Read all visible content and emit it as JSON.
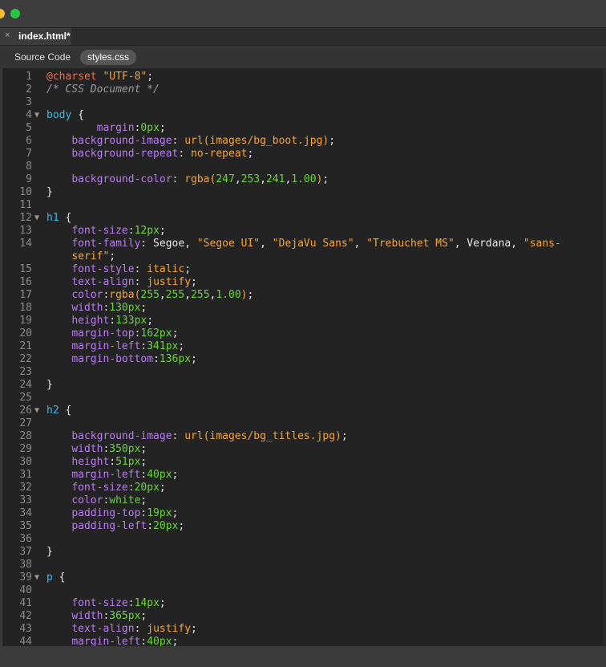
{
  "tab": {
    "close": "×",
    "filename": "index.html*"
  },
  "related_files": [
    "Source Code",
    "styles.css"
  ],
  "lines": [
    {
      "n": "1",
      "tokens": [
        [
          "at",
          "@charset"
        ],
        [
          "txt",
          " "
        ],
        [
          "str",
          "\"UTF-8\""
        ],
        [
          "txt",
          ";"
        ]
      ]
    },
    {
      "n": "2",
      "tokens": [
        [
          "com",
          "/* CSS Document */"
        ]
      ]
    },
    {
      "n": "3",
      "tokens": []
    },
    {
      "n": "4",
      "fold": "▼",
      "tokens": [
        [
          "sel",
          "body"
        ],
        [
          "txt",
          " {"
        ]
      ]
    },
    {
      "n": "5",
      "tokens": [
        [
          "txt",
          "        "
        ],
        [
          "prop",
          "margin"
        ],
        [
          "txt",
          ":"
        ],
        [
          "num",
          "0px"
        ],
        [
          "txt",
          ";"
        ]
      ]
    },
    {
      "n": "6",
      "tokens": [
        [
          "txt",
          "    "
        ],
        [
          "prop",
          "background-image"
        ],
        [
          "txt",
          ": "
        ],
        [
          "fn",
          "url(images/bg_boot.jpg)"
        ],
        [
          "txt",
          ";"
        ]
      ]
    },
    {
      "n": "7",
      "tokens": [
        [
          "txt",
          "    "
        ],
        [
          "prop",
          "background-repeat"
        ],
        [
          "txt",
          ": "
        ],
        [
          "kw",
          "no-repeat"
        ],
        [
          "txt",
          ";"
        ]
      ]
    },
    {
      "n": "8",
      "tokens": []
    },
    {
      "n": "9",
      "tokens": [
        [
          "txt",
          "    "
        ],
        [
          "prop",
          "background-color"
        ],
        [
          "txt",
          ": "
        ],
        [
          "fn",
          "rgba("
        ],
        [
          "num",
          "247"
        ],
        [
          "txt",
          ","
        ],
        [
          "num",
          "253"
        ],
        [
          "txt",
          ","
        ],
        [
          "num",
          "241"
        ],
        [
          "txt",
          ","
        ],
        [
          "num",
          "1.00"
        ],
        [
          "fn",
          ")"
        ],
        [
          "txt",
          ";"
        ]
      ]
    },
    {
      "n": "10",
      "tokens": [
        [
          "txt",
          "}"
        ]
      ]
    },
    {
      "n": "11",
      "tokens": []
    },
    {
      "n": "12",
      "fold": "▼",
      "tokens": [
        [
          "sel",
          "h1"
        ],
        [
          "txt",
          " {"
        ]
      ]
    },
    {
      "n": "13",
      "tokens": [
        [
          "txt",
          "    "
        ],
        [
          "prop",
          "font-size"
        ],
        [
          "txt",
          ":"
        ],
        [
          "num",
          "12px"
        ],
        [
          "txt",
          ";"
        ]
      ]
    },
    {
      "n": "14",
      "tokens": [
        [
          "txt",
          "    "
        ],
        [
          "prop",
          "font-family"
        ],
        [
          "txt",
          ": Segoe, "
        ],
        [
          "str",
          "\"Segoe UI\""
        ],
        [
          "txt",
          ", "
        ],
        [
          "str",
          "\"DejaVu Sans\""
        ],
        [
          "txt",
          ", "
        ],
        [
          "str",
          "\"Trebuchet MS\""
        ],
        [
          "txt",
          ", Verdana, "
        ],
        [
          "str",
          "\"sans-"
        ]
      ]
    },
    {
      "n": "",
      "tokens": [
        [
          "txt",
          "    "
        ],
        [
          "str",
          "serif\""
        ],
        [
          "txt",
          ";"
        ]
      ]
    },
    {
      "n": "15",
      "tokens": [
        [
          "txt",
          "    "
        ],
        [
          "prop",
          "font-style"
        ],
        [
          "txt",
          ": "
        ],
        [
          "kw",
          "italic"
        ],
        [
          "txt",
          ";"
        ]
      ]
    },
    {
      "n": "16",
      "tokens": [
        [
          "txt",
          "    "
        ],
        [
          "prop",
          "text-align"
        ],
        [
          "txt",
          ": "
        ],
        [
          "kw",
          "justify"
        ],
        [
          "txt",
          ";"
        ]
      ]
    },
    {
      "n": "17",
      "tokens": [
        [
          "txt",
          "    "
        ],
        [
          "prop",
          "color"
        ],
        [
          "txt",
          ":"
        ],
        [
          "fn",
          "rgba("
        ],
        [
          "num",
          "255"
        ],
        [
          "txt",
          ","
        ],
        [
          "num",
          "255"
        ],
        [
          "txt",
          ","
        ],
        [
          "num",
          "255"
        ],
        [
          "txt",
          ","
        ],
        [
          "num",
          "1.00"
        ],
        [
          "fn",
          ")"
        ],
        [
          "txt",
          ";"
        ]
      ]
    },
    {
      "n": "18",
      "tokens": [
        [
          "txt",
          "    "
        ],
        [
          "prop",
          "width"
        ],
        [
          "txt",
          ":"
        ],
        [
          "num",
          "130px"
        ],
        [
          "txt",
          ";"
        ]
      ]
    },
    {
      "n": "19",
      "tokens": [
        [
          "txt",
          "    "
        ],
        [
          "prop",
          "height"
        ],
        [
          "txt",
          ":"
        ],
        [
          "num",
          "133px"
        ],
        [
          "txt",
          ";"
        ]
      ]
    },
    {
      "n": "20",
      "tokens": [
        [
          "txt",
          "    "
        ],
        [
          "prop",
          "margin-top"
        ],
        [
          "txt",
          ":"
        ],
        [
          "num",
          "162px"
        ],
        [
          "txt",
          ";"
        ]
      ]
    },
    {
      "n": "21",
      "tokens": [
        [
          "txt",
          "    "
        ],
        [
          "prop",
          "margin-left"
        ],
        [
          "txt",
          ":"
        ],
        [
          "num",
          "341px"
        ],
        [
          "txt",
          ";"
        ]
      ]
    },
    {
      "n": "22",
      "tokens": [
        [
          "txt",
          "    "
        ],
        [
          "prop",
          "margin-bottom"
        ],
        [
          "txt",
          ":"
        ],
        [
          "num",
          "136px"
        ],
        [
          "txt",
          ";"
        ]
      ]
    },
    {
      "n": "23",
      "tokens": []
    },
    {
      "n": "24",
      "tokens": [
        [
          "txt",
          "}"
        ]
      ]
    },
    {
      "n": "25",
      "tokens": []
    },
    {
      "n": "26",
      "fold": "▼",
      "tokens": [
        [
          "sel",
          "h2"
        ],
        [
          "txt",
          " {"
        ]
      ]
    },
    {
      "n": "27",
      "tokens": []
    },
    {
      "n": "28",
      "tokens": [
        [
          "txt",
          "    "
        ],
        [
          "prop",
          "background-image"
        ],
        [
          "txt",
          ": "
        ],
        [
          "fn",
          "url(images/bg_titles.jpg)"
        ],
        [
          "txt",
          ";"
        ]
      ]
    },
    {
      "n": "29",
      "tokens": [
        [
          "txt",
          "    "
        ],
        [
          "prop",
          "width"
        ],
        [
          "txt",
          ":"
        ],
        [
          "num",
          "350px"
        ],
        [
          "txt",
          ";"
        ]
      ]
    },
    {
      "n": "30",
      "tokens": [
        [
          "txt",
          "    "
        ],
        [
          "prop",
          "height"
        ],
        [
          "txt",
          ":"
        ],
        [
          "num",
          "51px"
        ],
        [
          "txt",
          ";"
        ]
      ]
    },
    {
      "n": "31",
      "tokens": [
        [
          "txt",
          "    "
        ],
        [
          "prop",
          "margin-left"
        ],
        [
          "txt",
          ":"
        ],
        [
          "num",
          "40px"
        ],
        [
          "txt",
          ";"
        ]
      ]
    },
    {
      "n": "32",
      "tokens": [
        [
          "txt",
          "    "
        ],
        [
          "prop",
          "font-size"
        ],
        [
          "txt",
          ":"
        ],
        [
          "num",
          "20px"
        ],
        [
          "txt",
          ";"
        ]
      ]
    },
    {
      "n": "33",
      "tokens": [
        [
          "txt",
          "    "
        ],
        [
          "prop",
          "color"
        ],
        [
          "txt",
          ":"
        ],
        [
          "num",
          "white"
        ],
        [
          "txt",
          ";"
        ]
      ]
    },
    {
      "n": "34",
      "tokens": [
        [
          "txt",
          "    "
        ],
        [
          "prop",
          "padding-top"
        ],
        [
          "txt",
          ":"
        ],
        [
          "num",
          "19px"
        ],
        [
          "txt",
          ";"
        ]
      ]
    },
    {
      "n": "35",
      "tokens": [
        [
          "txt",
          "    "
        ],
        [
          "prop",
          "padding-left"
        ],
        [
          "txt",
          ":"
        ],
        [
          "num",
          "20px"
        ],
        [
          "txt",
          ";"
        ]
      ]
    },
    {
      "n": "36",
      "tokens": []
    },
    {
      "n": "37",
      "tokens": [
        [
          "txt",
          "}"
        ]
      ]
    },
    {
      "n": "38",
      "tokens": []
    },
    {
      "n": "39",
      "fold": "▼",
      "tokens": [
        [
          "sel",
          "p"
        ],
        [
          "txt",
          " {"
        ]
      ]
    },
    {
      "n": "40",
      "tokens": []
    },
    {
      "n": "41",
      "tokens": [
        [
          "txt",
          "    "
        ],
        [
          "prop",
          "font-size"
        ],
        [
          "txt",
          ":"
        ],
        [
          "num",
          "14px"
        ],
        [
          "txt",
          ";"
        ]
      ]
    },
    {
      "n": "42",
      "tokens": [
        [
          "txt",
          "    "
        ],
        [
          "prop",
          "width"
        ],
        [
          "txt",
          ":"
        ],
        [
          "num",
          "365px"
        ],
        [
          "txt",
          ";"
        ]
      ]
    },
    {
      "n": "43",
      "tokens": [
        [
          "txt",
          "    "
        ],
        [
          "prop",
          "text-align"
        ],
        [
          "txt",
          ": "
        ],
        [
          "kw",
          "justify"
        ],
        [
          "txt",
          ";"
        ]
      ]
    },
    {
      "n": "44",
      "tokens": [
        [
          "txt",
          "    "
        ],
        [
          "prop",
          "margin-left"
        ],
        [
          "txt",
          ":"
        ],
        [
          "num",
          "40px"
        ],
        [
          "txt",
          ";"
        ]
      ]
    }
  ]
}
